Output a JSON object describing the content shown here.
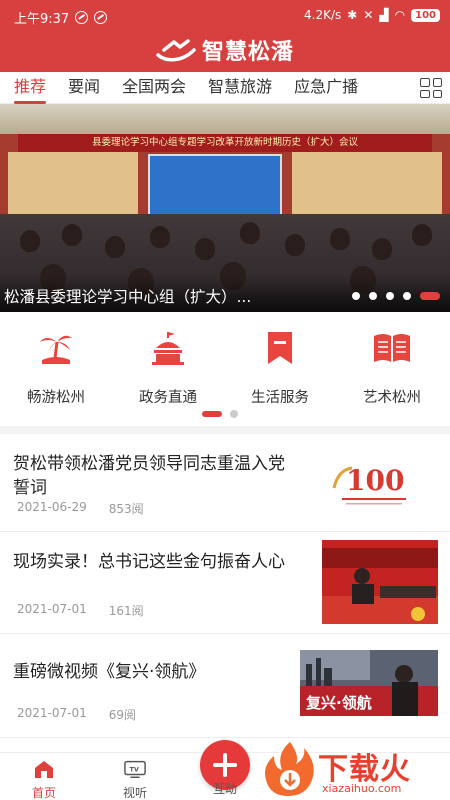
{
  "status_bar": {
    "time": "上午9:37",
    "speed": "4.2K/s",
    "battery": "100"
  },
  "header": {
    "app_title": "智慧松潘"
  },
  "tabs": [
    {
      "label": "推荐",
      "active": true
    },
    {
      "label": "要闻",
      "active": false
    },
    {
      "label": "全国两会",
      "active": false
    },
    {
      "label": "智慧旅游",
      "active": false
    },
    {
      "label": "应急广播",
      "active": false
    }
  ],
  "banner": {
    "sign_text": "县委理论学习中心组专题学习改革开放新时期历史（扩大）会议",
    "title": "松潘县委理论学习中心组（扩大）...",
    "slide_count": 5,
    "active_slide": 5
  },
  "quick_entries": [
    {
      "label": "畅游松州",
      "icon": "island-icon"
    },
    {
      "label": "政务直通",
      "icon": "government-icon"
    },
    {
      "label": "生活服务",
      "icon": "bookmark-icon"
    },
    {
      "label": "艺术松州",
      "icon": "book-icon"
    }
  ],
  "quick_pager": {
    "pages": 2,
    "active": 1
  },
  "news": [
    {
      "title": "贺松带领松潘党员领导同志重温入党誓词",
      "date": "2021-06-29",
      "reads": "853阅",
      "thumb": "100-anniversary-logo",
      "thumb_text": "100"
    },
    {
      "title": "现场实录！总书记这些金句振奋人心",
      "date": "2021-07-01",
      "reads": "161阅",
      "thumb": "ceremony-photo"
    },
    {
      "title": "重磅微视频《复兴·领航》",
      "date": "2021-07-01",
      "reads": "69阅",
      "thumb": "video-cover",
      "thumb_text": "复兴·领航"
    }
  ],
  "bottom_nav": {
    "home": "首页",
    "tv": "视听",
    "interact": "互动",
    "tv_icon_text": "TV"
  },
  "watermark": {
    "text": "下载火",
    "url": "xiazaihuo.com"
  },
  "colors": {
    "brand": "#d8403f",
    "accent": "#e0403c"
  }
}
